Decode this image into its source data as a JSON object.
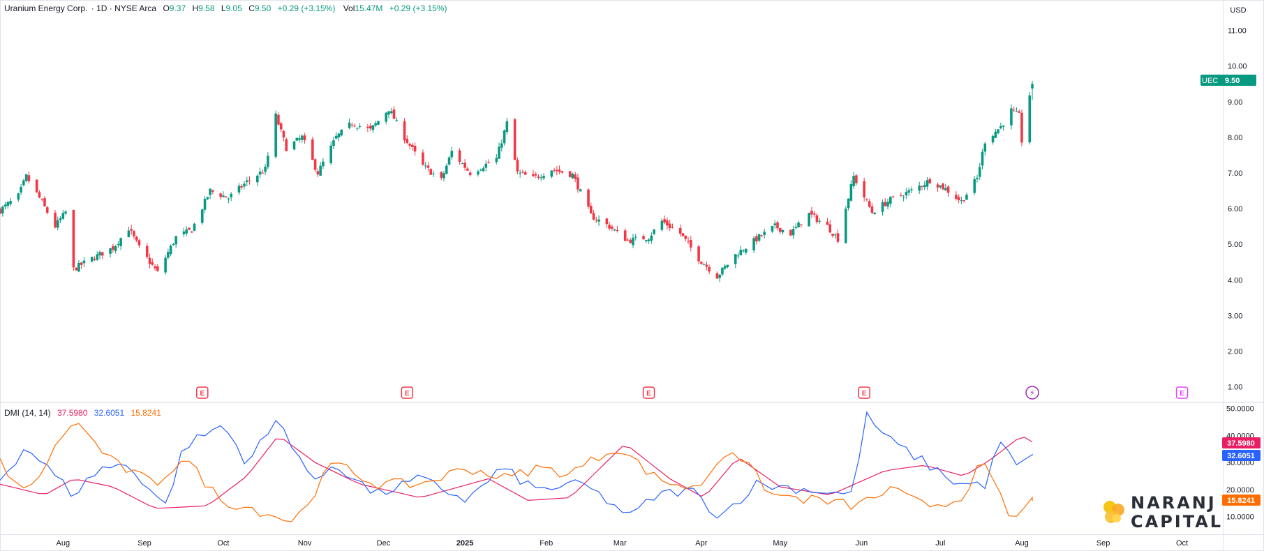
{
  "header": {
    "symbol_name": "Uranium Energy Corp.",
    "interval_exchange": "· 1D · NYSE Arca",
    "o_label": "O",
    "open": "9.37",
    "h_label": "H",
    "high": "9.58",
    "l_label": "L",
    "low": "9.05",
    "c_label": "C",
    "close": "9.50",
    "change": "+0.29 (+3.15%)",
    "vol_label": "Vol",
    "volume": "15.47M",
    "vol_change": "+0.29 (+3.15%)"
  },
  "currency": "USD",
  "price_tag": {
    "ticker": "UEC",
    "value": "9.50"
  },
  "dmi": {
    "label": "DMI (14, 14)",
    "adx_value": "37.5980",
    "plus_di_value": "32.6051",
    "minus_di_value": "15.8241"
  },
  "colors": {
    "up": "#089981",
    "down": "#f23645",
    "adx": "#e91e63",
    "plus_di": "#2962ff",
    "minus_di": "#ff6d00",
    "earnings": "#f23645",
    "dividend": "#9c27b0",
    "future_earnings": "#e040fb"
  },
  "event_markers": [
    {
      "type": "earnings",
      "label": "E",
      "date": "2024-09-23"
    },
    {
      "type": "earnings",
      "label": "E",
      "date": "2024-12-10"
    },
    {
      "type": "earnings",
      "label": "E",
      "date": "2025-03-12"
    },
    {
      "type": "earnings",
      "label": "E",
      "date": "2025-06-02"
    },
    {
      "type": "split-dividend",
      "label": "⚡",
      "date": "2025-08-05"
    },
    {
      "type": "future-earnings",
      "label": "E",
      "date": "2025-10-01"
    }
  ],
  "brand": {
    "line1": "NARANJ",
    "line2": "CAPITAL"
  },
  "chart_data": [
    {
      "type": "candlestick",
      "title": "Uranium Energy Corp. · 1D · NYSE Arca",
      "y_axis_ticks": [
        "1.00",
        "2.00",
        "3.00",
        "4.00",
        "5.00",
        "6.00",
        "7.00",
        "8.00",
        "9.00",
        "10.00",
        "11.00"
      ],
      "ylim": [
        0.6,
        11.5
      ],
      "x_axis_labels": [
        {
          "label": "Aug",
          "date": "2024-08-01"
        },
        {
          "label": "Sep",
          "date": "2024-09-01"
        },
        {
          "label": "Oct",
          "date": "2024-10-01"
        },
        {
          "label": "Nov",
          "date": "2024-11-01"
        },
        {
          "label": "Dec",
          "date": "2024-12-01"
        },
        {
          "label": "2025",
          "date": "2025-01-01"
        },
        {
          "label": "Feb",
          "date": "2025-02-01"
        },
        {
          "label": "Mar",
          "date": "2025-03-01"
        },
        {
          "label": "Apr",
          "date": "2025-04-01"
        },
        {
          "label": "May",
          "date": "2025-05-01"
        },
        {
          "label": "Jun",
          "date": "2025-06-01"
        },
        {
          "label": "Jul",
          "date": "2025-07-01"
        },
        {
          "label": "Aug",
          "date": "2025-08-01"
        },
        {
          "label": "Sep",
          "date": "2025-09-01"
        },
        {
          "label": "Oct",
          "date": "2025-10-01"
        }
      ],
      "xlim": [
        "2024-07-08",
        "2025-10-16"
      ],
      "close_path": [
        [
          "2024-07-08",
          5.95
        ],
        [
          "2024-07-15",
          6.35
        ],
        [
          "2024-07-18",
          6.9
        ],
        [
          "2024-07-23",
          6.3
        ],
        [
          "2024-07-29",
          5.5
        ],
        [
          "2024-08-02",
          5.9
        ],
        [
          "2024-08-05",
          4.3
        ],
        [
          "2024-08-12",
          4.6
        ],
        [
          "2024-08-20",
          4.9
        ],
        [
          "2024-08-26",
          5.45
        ],
        [
          "2024-08-30",
          4.9
        ],
        [
          "2024-09-06",
          4.2
        ],
        [
          "2024-09-13",
          5.2
        ],
        [
          "2024-09-19",
          5.4
        ],
        [
          "2024-09-26",
          6.5
        ],
        [
          "2024-10-03",
          6.3
        ],
        [
          "2024-10-10",
          6.75
        ],
        [
          "2024-10-17",
          7.1
        ],
        [
          "2024-10-21",
          8.6
        ],
        [
          "2024-10-25",
          7.7
        ],
        [
          "2024-10-31",
          8.0
        ],
        [
          "2024-11-06",
          7.0
        ],
        [
          "2024-11-13",
          8.0
        ],
        [
          "2024-11-19",
          8.4
        ],
        [
          "2024-11-26",
          8.2
        ],
        [
          "2024-12-03",
          8.8
        ],
        [
          "2024-12-09",
          8.0
        ],
        [
          "2024-12-16",
          7.2
        ],
        [
          "2024-12-23",
          6.8
        ],
        [
          "2024-12-27",
          7.6
        ],
        [
          "2025-01-03",
          7.0
        ],
        [
          "2025-01-13",
          7.4
        ],
        [
          "2025-01-17",
          8.4
        ],
        [
          "2025-01-21",
          7.0
        ],
        [
          "2025-01-27",
          6.85
        ],
        [
          "2025-02-03",
          7.1
        ],
        [
          "2025-02-11",
          6.95
        ],
        [
          "2025-02-18",
          5.8
        ],
        [
          "2025-02-25",
          5.5
        ],
        [
          "2025-03-04",
          5.1
        ],
        [
          "2025-03-12",
          5.2
        ],
        [
          "2025-03-17",
          5.65
        ],
        [
          "2025-03-24",
          5.3
        ],
        [
          "2025-03-31",
          4.6
        ],
        [
          "2025-04-07",
          4.1
        ],
        [
          "2025-04-14",
          4.7
        ],
        [
          "2025-04-23",
          5.2
        ],
        [
          "2025-04-29",
          5.5
        ],
        [
          "2025-05-05",
          5.3
        ],
        [
          "2025-05-12",
          5.85
        ],
        [
          "2025-05-19",
          5.5
        ],
        [
          "2025-05-23",
          5.15
        ],
        [
          "2025-05-29",
          6.9
        ],
        [
          "2025-06-05",
          5.9
        ],
        [
          "2025-06-12",
          6.25
        ],
        [
          "2025-06-20",
          6.5
        ],
        [
          "2025-06-27",
          6.8
        ],
        [
          "2025-07-03",
          6.55
        ],
        [
          "2025-07-09",
          6.2
        ],
        [
          "2025-07-15",
          6.85
        ],
        [
          "2025-07-18",
          7.9
        ],
        [
          "2025-07-24",
          8.3
        ],
        [
          "2025-07-28",
          8.75
        ],
        [
          "2025-07-31",
          8.6
        ],
        [
          "2025-08-01",
          7.9
        ],
        [
          "2025-08-04",
          9.2
        ],
        [
          "2025-08-05",
          9.5
        ]
      ],
      "last_bar": {
        "open": 9.37,
        "high": 9.58,
        "low": 9.05,
        "close": 9.5
      }
    },
    {
      "type": "line",
      "title": "DMI (14, 14)",
      "y_axis_ticks": [
        "10.0000",
        "20.0000",
        "30.0000",
        "40.0000",
        "50.0000"
      ],
      "ylim": [
        5,
        52
      ],
      "series": [
        {
          "key": "adx",
          "points": [
            [
              "2024-07-08",
              22
            ],
            [
              "2024-07-25",
              18
            ],
            [
              "2024-08-05",
              24
            ],
            [
              "2024-08-20",
              21
            ],
            [
              "2024-09-05",
              13
            ],
            [
              "2024-09-25",
              14
            ],
            [
              "2024-10-10",
              25
            ],
            [
              "2024-10-22",
              40
            ],
            [
              "2024-11-05",
              30
            ],
            [
              "2024-11-22",
              22
            ],
            [
              "2024-12-15",
              17
            ],
            [
              "2025-01-10",
              24
            ],
            [
              "2025-01-25",
              16
            ],
            [
              "2025-02-10",
              17
            ],
            [
              "2025-03-03",
              37
            ],
            [
              "2025-03-20",
              24
            ],
            [
              "2025-04-02",
              17
            ],
            [
              "2025-04-15",
              32
            ],
            [
              "2025-05-01",
              21
            ],
            [
              "2025-05-20",
              18
            ],
            [
              "2025-06-10",
              27
            ],
            [
              "2025-06-25",
              29
            ],
            [
              "2025-07-10",
              25
            ],
            [
              "2025-07-20",
              31
            ],
            [
              "2025-08-01",
              40
            ],
            [
              "2025-08-05",
              37.6
            ]
          ]
        },
        {
          "key": "plus_di",
          "points": [
            [
              "2024-07-08",
              24
            ],
            [
              "2024-07-18",
              36
            ],
            [
              "2024-08-05",
              18
            ],
            [
              "2024-08-15",
              28
            ],
            [
              "2024-08-26",
              29
            ],
            [
              "2024-09-09",
              14
            ],
            [
              "2024-09-16",
              36
            ],
            [
              "2024-10-01",
              44
            ],
            [
              "2024-10-10",
              30
            ],
            [
              "2024-10-22",
              46
            ],
            [
              "2024-11-05",
              22
            ],
            [
              "2024-11-12",
              30
            ],
            [
              "2024-11-28",
              18
            ],
            [
              "2024-12-15",
              24
            ],
            [
              "2025-01-02",
              16
            ],
            [
              "2025-01-15",
              28
            ],
            [
              "2025-01-28",
              20
            ],
            [
              "2025-02-15",
              22
            ],
            [
              "2025-03-05",
              10
            ],
            [
              "2025-03-15",
              18
            ],
            [
              "2025-03-28",
              20
            ],
            [
              "2025-04-08",
              10
            ],
            [
              "2025-04-22",
              22
            ],
            [
              "2025-05-12",
              20
            ],
            [
              "2025-05-28",
              18
            ],
            [
              "2025-06-03",
              47
            ],
            [
              "2025-06-12",
              38
            ],
            [
              "2025-06-25",
              30
            ],
            [
              "2025-07-08",
              22
            ],
            [
              "2025-07-18",
              22
            ],
            [
              "2025-07-24",
              38
            ],
            [
              "2025-07-30",
              28
            ],
            [
              "2025-08-05",
              32.6
            ]
          ]
        },
        {
          "key": "minus_di",
          "points": [
            [
              "2024-07-08",
              30
            ],
            [
              "2024-07-18",
              18
            ],
            [
              "2024-08-05",
              46
            ],
            [
              "2024-08-20",
              30
            ],
            [
              "2024-09-05",
              22
            ],
            [
              "2024-09-16",
              32
            ],
            [
              "2024-09-30",
              16
            ],
            [
              "2024-10-12",
              13
            ],
            [
              "2024-10-28",
              8
            ],
            [
              "2024-11-12",
              30
            ],
            [
              "2024-11-28",
              22
            ],
            [
              "2024-12-15",
              22
            ],
            [
              "2025-01-02",
              28
            ],
            [
              "2025-01-17",
              24
            ],
            [
              "2025-01-28",
              28
            ],
            [
              "2025-02-10",
              26
            ],
            [
              "2025-02-28",
              36
            ],
            [
              "2025-03-15",
              24
            ],
            [
              "2025-03-30",
              20
            ],
            [
              "2025-04-12",
              36
            ],
            [
              "2025-04-28",
              18
            ],
            [
              "2025-05-15",
              16
            ],
            [
              "2025-05-30",
              14
            ],
            [
              "2025-06-12",
              20
            ],
            [
              "2025-06-25",
              14
            ],
            [
              "2025-07-08",
              16
            ],
            [
              "2025-07-17",
              30
            ],
            [
              "2025-07-28",
              9
            ],
            [
              "2025-08-01",
              10
            ],
            [
              "2025-08-04",
              19
            ],
            [
              "2025-08-05",
              15.8
            ]
          ]
        }
      ]
    }
  ]
}
